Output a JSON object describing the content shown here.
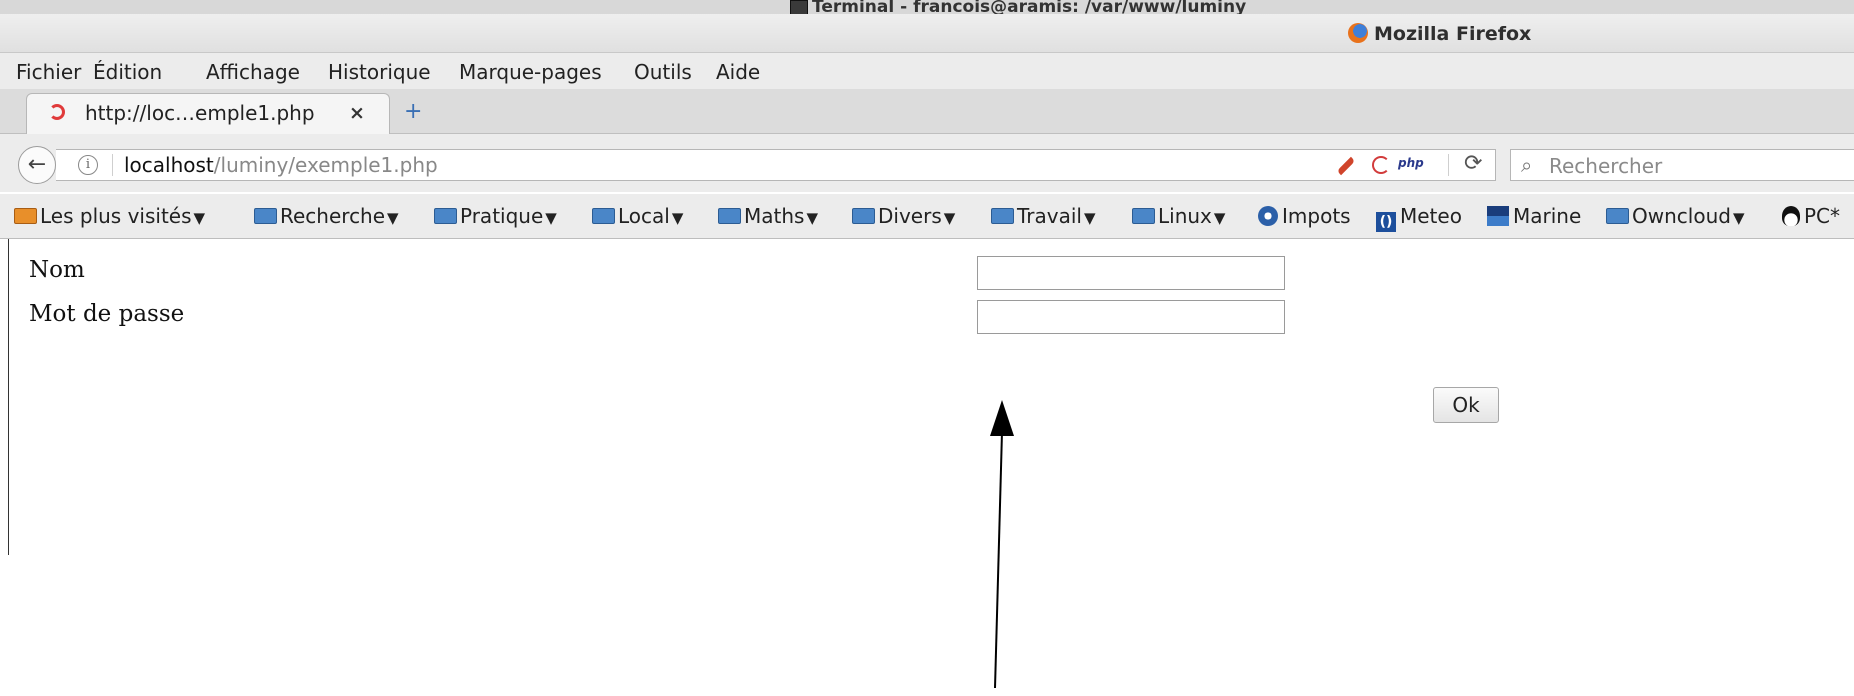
{
  "terminal": {
    "title": "Terminal - francois@aramis: /var/www/luminy"
  },
  "window": {
    "title": "Mozilla Firefox"
  },
  "menu": [
    "Fichier",
    "Édition",
    "Affichage",
    "Historique",
    "Marque-pages",
    "Outils",
    "Aide"
  ],
  "tab": {
    "label": "http://loc…emple1.php",
    "close": "×",
    "new": "+"
  },
  "nav": {
    "back": "←",
    "url_host": "localhost",
    "url_path": "/luminy/exemple1.php",
    "php_badge": "php",
    "reload": "⟳",
    "search_placeholder": "Rechercher"
  },
  "bookmarks": [
    {
      "label": "Les plus visités",
      "icon": "orange-folder-icon",
      "has_menu": true
    },
    {
      "label": "Recherche",
      "icon": "folder-icon",
      "has_menu": true
    },
    {
      "label": "Pratique",
      "icon": "folder-icon",
      "has_menu": true
    },
    {
      "label": "Local",
      "icon": "folder-icon",
      "has_menu": true
    },
    {
      "label": "Maths",
      "icon": "folder-icon",
      "has_menu": true
    },
    {
      "label": "Divers",
      "icon": "folder-icon",
      "has_menu": true
    },
    {
      "label": "Travail",
      "icon": "folder-icon",
      "has_menu": true
    },
    {
      "label": "Linux",
      "icon": "folder-icon",
      "has_menu": true
    },
    {
      "label": "Impots",
      "icon": "impots-icon",
      "has_menu": false
    },
    {
      "label": "Meteo",
      "icon": "meteo-icon",
      "has_menu": false
    },
    {
      "label": "Marine",
      "icon": "marine-icon",
      "has_menu": false
    },
    {
      "label": "Owncloud",
      "icon": "folder-icon",
      "has_menu": true
    },
    {
      "label": "PC*",
      "icon": "tux-icon",
      "has_menu": false
    }
  ],
  "form": {
    "name_label": "Nom",
    "password_label": "Mot de passe",
    "name_value": "",
    "password_value": "",
    "submit_label": "Ok"
  }
}
